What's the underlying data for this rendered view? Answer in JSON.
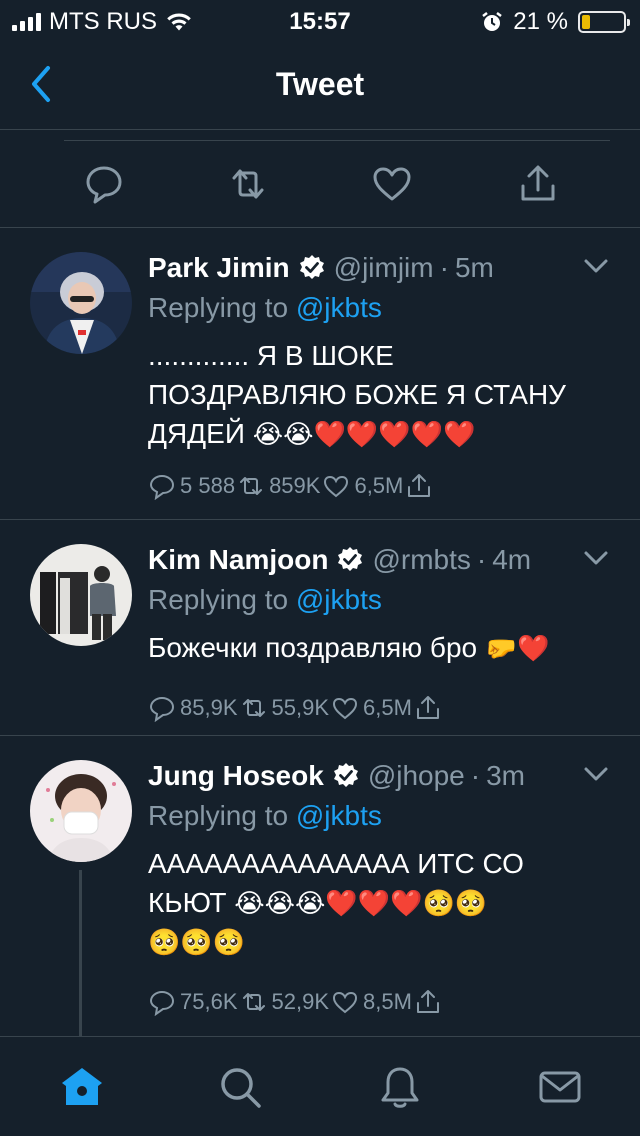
{
  "status_bar": {
    "carrier": "MTS RUS",
    "time": "15:57",
    "battery": "21 %",
    "battery_level": 0.21,
    "icons": [
      "signal-icon",
      "wifi-icon",
      "alarm-icon",
      "battery-icon"
    ]
  },
  "header": {
    "title": "Tweet",
    "back_icon": "chevron-left-icon"
  },
  "colors": {
    "background": "#15202b",
    "divider": "#38444d",
    "accent": "#1da1f2",
    "muted": "#8899a6"
  },
  "main_actions": [
    "reply-icon",
    "retweet-icon",
    "like-icon",
    "share-icon"
  ],
  "tweets": [
    {
      "name": "Park Jimin",
      "handle": "@jimjim",
      "time": "5m",
      "replying_prefix": "Replying to",
      "replying_to": "@jkbts",
      "text_line1": "............. Я В ШОКЕ",
      "text_line2": "ПОЗДРАВЛЯЮ БОЖЕ Я СТАНУ",
      "text_line3": "ДЯДЕЙ",
      "emoji": "😭😭❤️❤️❤️❤️❤️",
      "replies": "5 588",
      "retweets": "859K",
      "likes": "6,5M"
    },
    {
      "name": "Kim Namjoon",
      "handle": "@rmbts",
      "time": "4m",
      "replying_prefix": "Replying to",
      "replying_to": "@jkbts",
      "text_line1": "Божечки поздравляю бро",
      "emoji": "🤛❤️",
      "replies": "85,9K",
      "retweets": "55,9K",
      "likes": "6,5M"
    },
    {
      "name": "Jung Hoseok",
      "handle": "@jhope",
      "time": "3m",
      "replying_prefix": "Replying to",
      "replying_to": "@jkbts",
      "text_line1": "АААААААААААААА ИТС СО",
      "text_line2": "КЬЮТ",
      "emoji_line2": "😭😭😭❤️❤️❤️🥺🥺",
      "emoji_line3": "🥺🥺🥺",
      "replies": "75,6K",
      "retweets": "52,9K",
      "likes": "8,5M"
    }
  ],
  "tabbar": [
    "home-icon",
    "search-icon",
    "notifications-icon",
    "messages-icon"
  ]
}
